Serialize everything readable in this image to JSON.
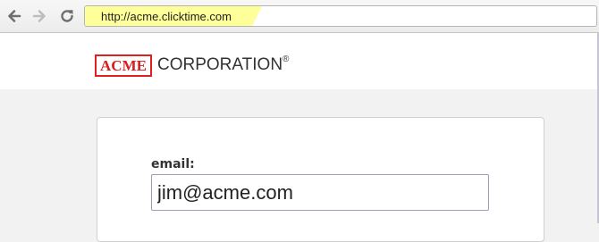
{
  "browser": {
    "url": "http://acme.clicktime.com",
    "nav_icons": [
      "back-arrow-icon",
      "forward-arrow-icon",
      "reload-icon"
    ],
    "url_highlight_color": "#ffff99"
  },
  "header": {
    "logo_text": "ACME",
    "logo_color": "#d81e1e",
    "company_name": "CORPORATION",
    "registered_mark": "®"
  },
  "login": {
    "email_label": "email:",
    "email_value": "jim@acme.com"
  }
}
